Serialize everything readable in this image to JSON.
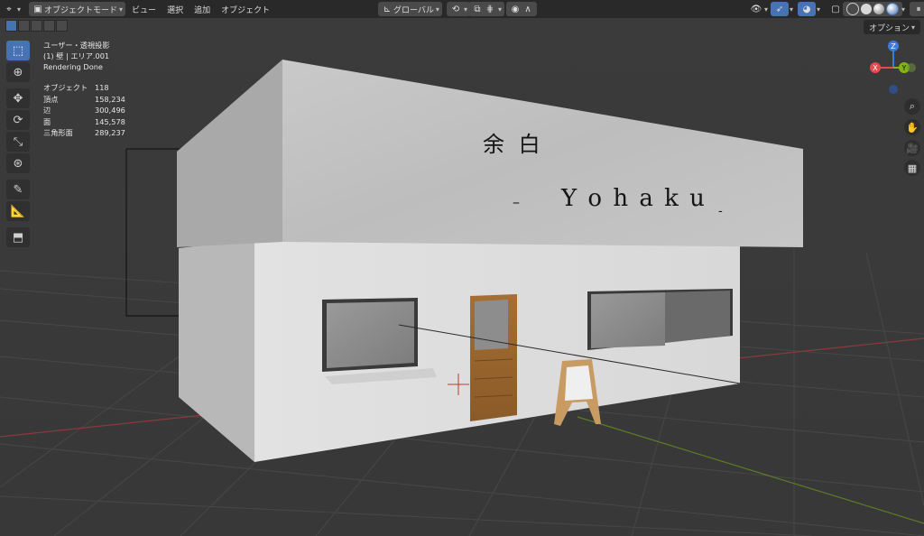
{
  "header": {
    "mode_label": "オブジェクトモード",
    "menus": [
      "ビュー",
      "選択",
      "追加",
      "オブジェクト"
    ],
    "transform_orientation": "グローバル",
    "options_label": "オプション"
  },
  "overlay": {
    "view_name": "ユーザー・透視投影",
    "active_object": "(1) 壁 | エリア.001",
    "render_status": "Rendering Done",
    "stats": [
      {
        "label": "オブジェクト",
        "value": "118"
      },
      {
        "label": "頂点",
        "value": "158,234"
      },
      {
        "label": "辺",
        "value": "300,496"
      },
      {
        "label": "面",
        "value": "145,578"
      },
      {
        "label": "三角形面",
        "value": "289,237"
      }
    ]
  },
  "gizmo": {
    "z": "Z",
    "x": "X",
    "y": "Y"
  },
  "signage": {
    "kanji": "余 白",
    "roman": "Y o h a k u",
    "dash_left": "–",
    "dash_right": "-"
  },
  "colors": {
    "accent": "#4772b3",
    "axis_x": "#e5484d",
    "axis_y": "#82b417",
    "axis_z": "#3d7ae0"
  },
  "icons": {
    "toolbar": [
      "select-box-icon",
      "cursor-icon",
      "move-icon",
      "rotate-icon",
      "scale-icon",
      "transform-icon",
      "annotate-icon",
      "measure-icon",
      "add-cube-icon"
    ],
    "nav": [
      "zoom-icon",
      "hand-icon",
      "camera-icon",
      "grid-icon"
    ]
  }
}
